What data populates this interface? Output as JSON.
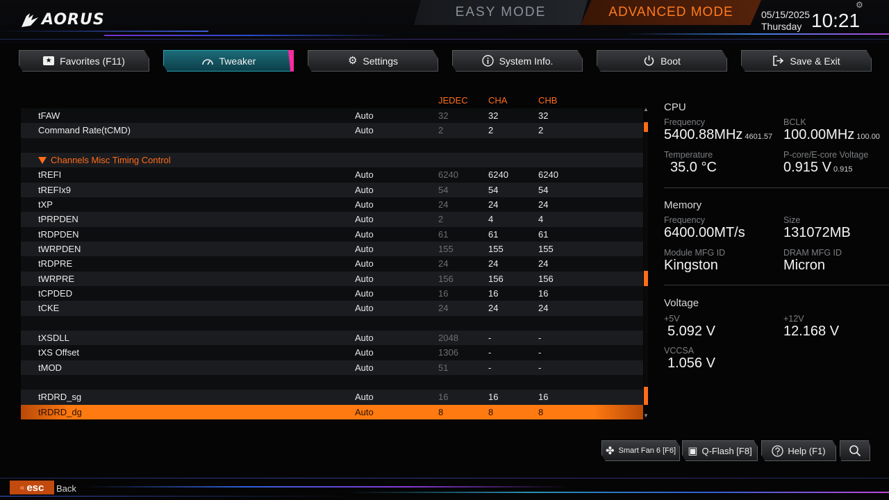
{
  "brand": "AORUS",
  "modes": {
    "easy": "EASY MODE",
    "advanced": "ADVANCED MODE"
  },
  "datetime": {
    "date": "05/15/2025",
    "day": "Thursday",
    "time": "10:21"
  },
  "tabs": [
    {
      "label": "Favorites (F11)",
      "icon": "star-icon",
      "active": false
    },
    {
      "label": "Tweaker",
      "icon": "gauge-icon",
      "active": true
    },
    {
      "label": "Settings",
      "icon": "gear-icon",
      "active": false
    },
    {
      "label": "System Info.",
      "icon": "info-icon",
      "active": false
    },
    {
      "label": "Boot",
      "icon": "power-icon",
      "active": false
    },
    {
      "label": "Save & Exit",
      "icon": "exit-icon",
      "active": false
    }
  ],
  "columns": {
    "jedec": "JEDEC",
    "cha": "CHA",
    "chb": "CHB"
  },
  "rows": [
    {
      "name": "tFAW",
      "mode": "Auto",
      "jedec": "32",
      "cha": "32",
      "chb": "32"
    },
    {
      "name": "Command Rate(tCMD)",
      "mode": "Auto",
      "jedec": "2",
      "cha": "2",
      "chb": "2"
    },
    {
      "name": "",
      "mode": "",
      "jedec": "",
      "cha": "",
      "chb": ""
    },
    {
      "name": "Channels Misc Timing Control",
      "section": true
    },
    {
      "name": "tREFI",
      "mode": "Auto",
      "jedec": "6240",
      "cha": "6240",
      "chb": "6240"
    },
    {
      "name": "tREFIx9",
      "mode": "Auto",
      "jedec": "54",
      "cha": "54",
      "chb": "54"
    },
    {
      "name": "tXP",
      "mode": "Auto",
      "jedec": "24",
      "cha": "24",
      "chb": "24"
    },
    {
      "name": "tPRPDEN",
      "mode": "Auto",
      "jedec": "2",
      "cha": "4",
      "chb": "4"
    },
    {
      "name": "tRDPDEN",
      "mode": "Auto",
      "jedec": "61",
      "cha": "61",
      "chb": "61"
    },
    {
      "name": "tWRPDEN",
      "mode": "Auto",
      "jedec": "155",
      "cha": "155",
      "chb": "155"
    },
    {
      "name": "tRDPRE",
      "mode": "Auto",
      "jedec": "24",
      "cha": "24",
      "chb": "24"
    },
    {
      "name": "tWRPRE",
      "mode": "Auto",
      "jedec": "156",
      "cha": "156",
      "chb": "156"
    },
    {
      "name": "tCPDED",
      "mode": "Auto",
      "jedec": "16",
      "cha": "16",
      "chb": "16"
    },
    {
      "name": "tCKE",
      "mode": "Auto",
      "jedec": "24",
      "cha": "24",
      "chb": "24"
    },
    {
      "name": "",
      "mode": "",
      "jedec": "",
      "cha": "",
      "chb": ""
    },
    {
      "name": "tXSDLL",
      "mode": "Auto",
      "jedec": "2048",
      "cha": "-",
      "chb": "-"
    },
    {
      "name": "tXS Offset",
      "mode": "Auto",
      "jedec": "1306",
      "cha": "-",
      "chb": "-"
    },
    {
      "name": "tMOD",
      "mode": "Auto",
      "jedec": "51",
      "cha": "-",
      "chb": "-"
    },
    {
      "name": "",
      "mode": "",
      "jedec": "",
      "cha": "",
      "chb": ""
    },
    {
      "name": "tRDRD_sg",
      "mode": "Auto",
      "jedec": "16",
      "cha": "16",
      "chb": "16"
    },
    {
      "name": "tRDRD_dg",
      "mode": "Auto",
      "jedec": "8",
      "cha": "8",
      "chb": "8",
      "selected": true
    }
  ],
  "cpu": {
    "title": "CPU",
    "frequency_label": "Frequency",
    "frequency": "5400.88MHz",
    "frequency_sub": "4601.57",
    "bclk_label": "BCLK",
    "bclk": "100.00MHz",
    "bclk_sub": "100.00",
    "temp_label": "Temperature",
    "temp": "35.0 °C",
    "voltage_label": "P-core/E-core Voltage",
    "voltage": "0.915 V",
    "voltage_sub": "0.915"
  },
  "memory": {
    "title": "Memory",
    "frequency_label": "Frequency",
    "frequency": "6400.00MT/s",
    "size_label": "Size",
    "size": "131072MB",
    "module_label": "Module MFG ID",
    "module": "Kingston",
    "dram_label": "DRAM MFG ID",
    "dram": "Micron"
  },
  "voltage": {
    "title": "Voltage",
    "v5_label": "+5V",
    "v5": "5.092 V",
    "v12_label": "+12V",
    "v12": "12.168 V",
    "vccsa_label": "VCCSA",
    "vccsa": "1.056 V"
  },
  "bottom_buttons": [
    {
      "label": "Smart Fan 6 [F6]",
      "icon": "fan-icon"
    },
    {
      "label": "Q-Flash [F8]",
      "icon": "chip-icon"
    },
    {
      "label": "Help (F1)",
      "icon": "help-icon"
    },
    {
      "label": "",
      "icon": "search-icon"
    }
  ],
  "footer": {
    "esc": "esc",
    "back": "Back"
  },
  "colors": {
    "accent": "#ff6d1a",
    "active_tab": "#1c6b78",
    "tweaker_accent": "#ff2aa0"
  }
}
